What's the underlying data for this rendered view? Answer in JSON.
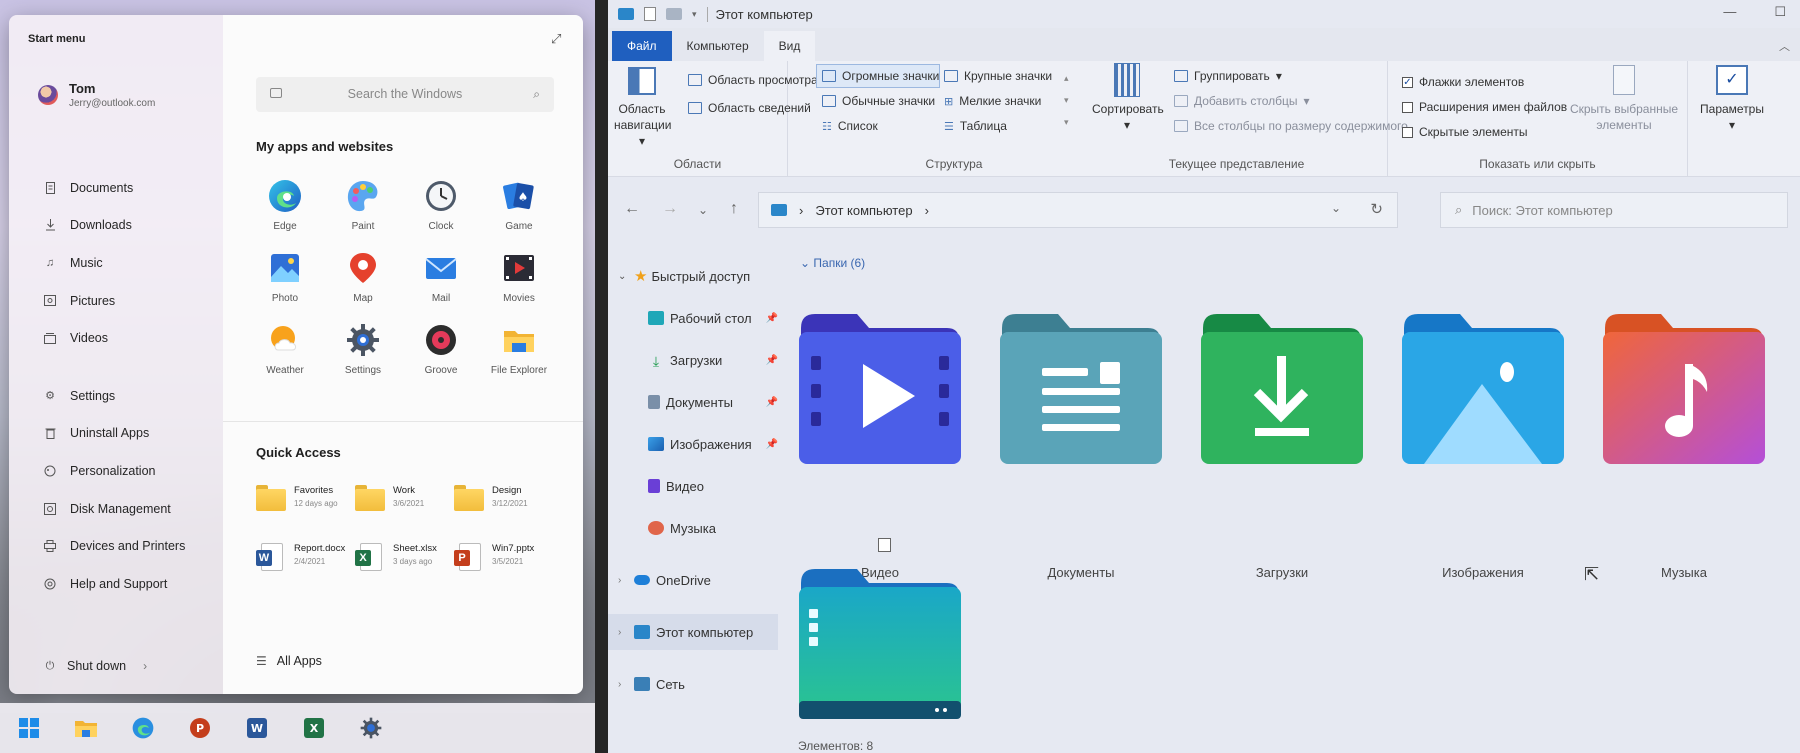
{
  "start_menu": {
    "title": "Start menu",
    "user": {
      "name": "Tom",
      "email": "Jerry@outlook.com"
    },
    "nav_primary": [
      {
        "label": "Documents",
        "icon": "document-icon"
      },
      {
        "label": "Downloads",
        "icon": "download-icon"
      },
      {
        "label": "Music",
        "icon": "music-icon"
      },
      {
        "label": "Pictures",
        "icon": "pictures-icon"
      },
      {
        "label": "Videos",
        "icon": "video-icon"
      }
    ],
    "nav_secondary": [
      {
        "label": "Settings",
        "icon": "gear-icon"
      },
      {
        "label": "Uninstall Apps",
        "icon": "trash-icon"
      },
      {
        "label": "Personalization",
        "icon": "palette-icon"
      },
      {
        "label": "Disk Management",
        "icon": "disk-icon"
      },
      {
        "label": "Devices and Printers",
        "icon": "printer-icon"
      },
      {
        "label": "Help and Support",
        "icon": "help-icon"
      }
    ],
    "shutdown_label": "Shut down",
    "search_placeholder": "Search the Windows",
    "apps_title": "My apps and websites",
    "apps": [
      {
        "label": "Edge",
        "icon": "edge-icon"
      },
      {
        "label": "Paint",
        "icon": "paint-icon"
      },
      {
        "label": "Clock",
        "icon": "clock-icon"
      },
      {
        "label": "Game",
        "icon": "game-icon"
      },
      {
        "label": "Photo",
        "icon": "photo-icon"
      },
      {
        "label": "Map",
        "icon": "map-icon"
      },
      {
        "label": "Mail",
        "icon": "mail-icon"
      },
      {
        "label": "Movies",
        "icon": "movies-icon"
      },
      {
        "label": "Weather",
        "icon": "weather-icon"
      },
      {
        "label": "Settings",
        "icon": "gear-icon"
      },
      {
        "label": "Groove",
        "icon": "groove-icon"
      },
      {
        "label": "File Explorer",
        "icon": "file-explorer-icon"
      }
    ],
    "quick_title": "Quick Access",
    "quick_items": [
      {
        "name": "Favorites",
        "date": "12 days ago",
        "kind": "folder"
      },
      {
        "name": "Work",
        "date": "3/6/2021",
        "kind": "folder"
      },
      {
        "name": "Design",
        "date": "3/12/2021",
        "kind": "folder"
      },
      {
        "name": "Report.docx",
        "date": "2/4/2021",
        "kind": "word"
      },
      {
        "name": "Sheet.xlsx",
        "date": "3 days ago",
        "kind": "excel"
      },
      {
        "name": "Win7.pptx",
        "date": "3/5/2021",
        "kind": "powerpoint"
      }
    ],
    "all_apps_label": "All Apps"
  },
  "taskbar": [
    "windows-logo-icon",
    "file-explorer-icon",
    "edge-icon",
    "powerpoint-icon",
    "word-icon",
    "excel-icon",
    "gear-icon"
  ],
  "explorer": {
    "window_title": "Этот компьютер",
    "tabs": [
      "Файл",
      "Компьютер",
      "Вид"
    ],
    "ribbon": {
      "areas": {
        "navigation_pane": "Область навигации",
        "preview_pane": "Область просмотра",
        "details_pane": "Область сведений",
        "label": "Области"
      },
      "layout": {
        "huge_icons": "Огромные значки",
        "large_icons": "Крупные значки",
        "normal_icons": "Обычные значки",
        "small_icons": "Мелкие значки",
        "list": "Список",
        "table": "Таблица",
        "label": "Структура"
      },
      "current_view": {
        "sort": "Сортировать",
        "group": "Группировать",
        "add_columns": "Добавить столбцы",
        "fit_columns": "Все столбцы по размеру содержимого",
        "label": "Текущее представление"
      },
      "show_hide": {
        "item_checkboxes": "Флажки элементов",
        "extensions": "Расширения имен файлов",
        "hidden_items": "Скрытые элементы",
        "hide_selected": "Скрыть выбранные элементы",
        "label": "Показать или скрыть"
      },
      "options": "Параметры"
    },
    "address": "Этот компьютер",
    "search_placeholder": "Поиск: Этот компьютер",
    "sidebar": {
      "quick_access": "Быстрый доступ",
      "items": [
        {
          "label": "Рабочий стол",
          "pinned": true
        },
        {
          "label": "Загрузки",
          "pinned": true
        },
        {
          "label": "Документы",
          "pinned": true
        },
        {
          "label": "Изображения",
          "pinned": true
        },
        {
          "label": "Видео",
          "pinned": false
        },
        {
          "label": "Музыка",
          "pinned": false
        }
      ],
      "onedrive": "OneDrive",
      "this_pc": "Этот компьютер",
      "network": "Сеть"
    },
    "group_header": "Папки (6)",
    "folders": [
      {
        "label": "Видео",
        "kind": "video"
      },
      {
        "label": "Документы",
        "kind": "documents"
      },
      {
        "label": "Загрузки",
        "kind": "downloads"
      },
      {
        "label": "Изображения",
        "kind": "pictures"
      },
      {
        "label": "Музыка",
        "kind": "music"
      },
      {
        "label": "",
        "kind": "desktop"
      }
    ],
    "status": "Элементов: 8"
  }
}
